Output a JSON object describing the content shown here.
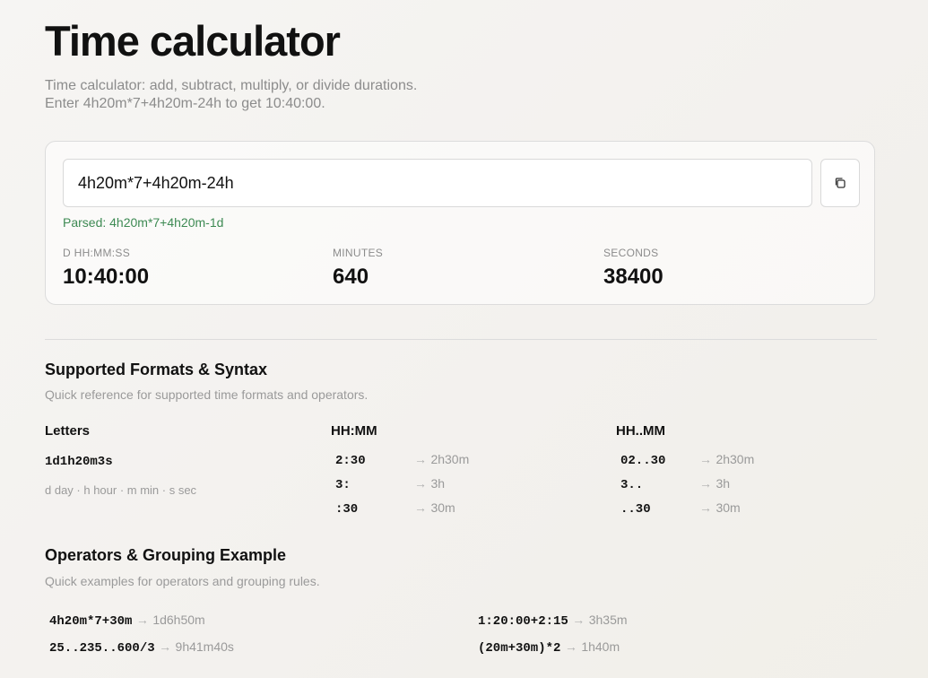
{
  "page": {
    "title": "Time calculator",
    "subtitle_line1": "Time calculator: add, subtract, multiply, or divide durations.",
    "subtitle_line2": "Enter 4h20m*7+4h20m-24h to get 10:40:00."
  },
  "calculator": {
    "input_value": "4h20m*7+4h20m-24h",
    "parsed_text": "Parsed: 4h20m*7+4h20m-1d",
    "copy_icon": "copy-icon",
    "results": [
      {
        "label": "D HH:MM:SS",
        "value": "10:40:00"
      },
      {
        "label": "MINUTES",
        "value": "640"
      },
      {
        "label": "SECONDS",
        "value": "38400"
      }
    ]
  },
  "formats": {
    "title": "Supported Formats & Syntax",
    "description": "Quick reference for supported time formats and operators.",
    "letters": {
      "title": "Letters",
      "example": "1d1h20m3s",
      "legend": "d day · h hour · m min · s sec"
    },
    "hhmm": {
      "title": "HH:MM",
      "rows": [
        {
          "input": "2:30",
          "arrow": "→",
          "result": "2h30m"
        },
        {
          "input": "3:",
          "arrow": "→",
          "result": "3h"
        },
        {
          "input": ":30",
          "arrow": "→",
          "result": "30m"
        }
      ]
    },
    "hhdotmm": {
      "title": "HH..MM",
      "rows": [
        {
          "input": "02..30",
          "arrow": "→",
          "result": "2h30m"
        },
        {
          "input": "3..",
          "arrow": "→",
          "result": "3h"
        },
        {
          "input": "..30",
          "arrow": "→",
          "result": "30m"
        }
      ]
    }
  },
  "operators": {
    "title": "Operators & Grouping Example",
    "description": "Quick examples for operators and grouping rules.",
    "examples": [
      {
        "input": "4h20m*7+30m",
        "arrow": "→",
        "result": "1d6h50m"
      },
      {
        "input": "1:20:00+2:15",
        "arrow": "→",
        "result": "3h35m"
      },
      {
        "input": "25..235..600/3",
        "arrow": "→",
        "result": "9h41m40s"
      },
      {
        "input": "(20m+30m)*2",
        "arrow": "→",
        "result": "1h40m"
      }
    ]
  }
}
